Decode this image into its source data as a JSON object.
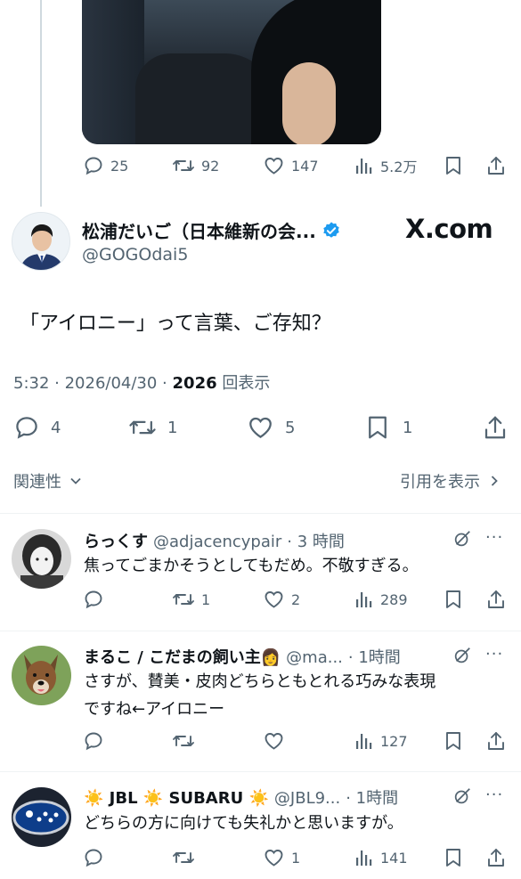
{
  "parent_tweet": {
    "stats": {
      "replies": "25",
      "retweets": "92",
      "likes": "147",
      "views": "5.2万"
    }
  },
  "main_tweet": {
    "author_name": "松浦だいご（日本維新の会...",
    "author_handle": "@GOGOdai5",
    "watermark": "X.com",
    "text": "「アイロニー」って言葉、ご存知？",
    "time_date": "5:32 · 2026/04/30 ·",
    "views_count": "2026",
    "views_label": "回表示",
    "stats": {
      "replies": "4",
      "retweets": "1",
      "likes": "5",
      "bookmarks": "1"
    }
  },
  "sort": {
    "relevance_label": "関連性",
    "quotes_label": "引用を表示"
  },
  "replies": [
    {
      "name": "らっくす",
      "handle": "@adjacencypair",
      "time": "· 3 時間",
      "text": "焦ってごまかそうとしてもだめ。不敬すぎる。",
      "retweets": "1",
      "likes": "2",
      "views": "289"
    },
    {
      "name": "まるこ / こだまの飼い主👩",
      "handle": "@ma...",
      "time": "· 1時間",
      "text_line1": "さすが、賛美・皮肉どちらともとれる巧みな表現",
      "text_line2": "ですね←アイロニー",
      "retweets": "",
      "likes": "",
      "views": "127"
    },
    {
      "name": "☀️ JBL ☀️ SUBARU ☀️",
      "handle": "@JBL9...",
      "time": "· 1時間",
      "text": "どちらの方に向けても失礼かと思いますが。",
      "retweets": "",
      "likes": "1",
      "views": "141"
    }
  ],
  "colors": {
    "text": "#0f1419",
    "muted": "#536471",
    "verified": "#1d9bf0",
    "divider": "#eff3f4"
  }
}
